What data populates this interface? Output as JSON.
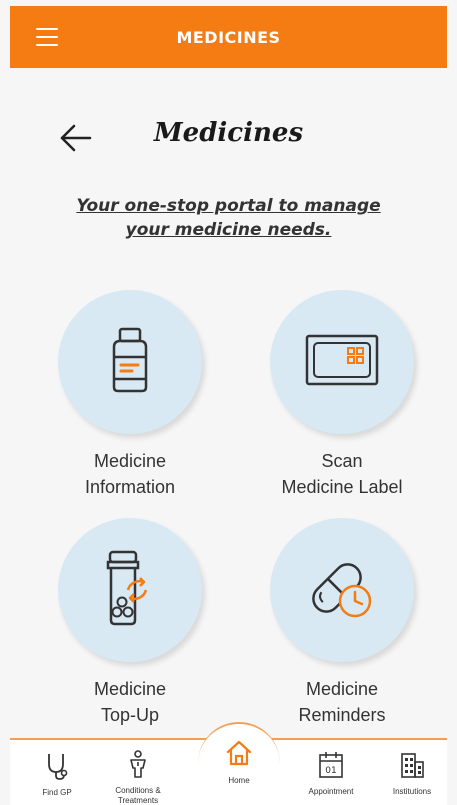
{
  "header": {
    "title": "MEDICINES"
  },
  "page": {
    "title": "Medicines",
    "tagline_line1": "Your one-stop portal to manage",
    "tagline_line2": "your medicine needs."
  },
  "tiles": [
    {
      "line1": "Medicine",
      "line2": "Information",
      "icon": "medicine-bottle-icon"
    },
    {
      "line1": "Scan",
      "line2": "Medicine Label",
      "icon": "scan-label-icon"
    },
    {
      "line1": "Medicine",
      "line2": "Top-Up",
      "icon": "pill-bottle-refill-icon"
    },
    {
      "line1": "Medicine",
      "line2": "Reminders",
      "icon": "pill-clock-icon"
    }
  ],
  "nav": {
    "find_gp": "Find GP",
    "conditions_line1": "Conditions &",
    "conditions_line2": "Treatments",
    "home": "Home",
    "appointment": "Appointment",
    "appointment_icon_text": "01",
    "institutions": "Institutions"
  },
  "colors": {
    "accent": "#f57c12",
    "tile_circle": "#d8e9f4",
    "icon_stroke": "#333333",
    "icon_accent": "#f57c12"
  }
}
